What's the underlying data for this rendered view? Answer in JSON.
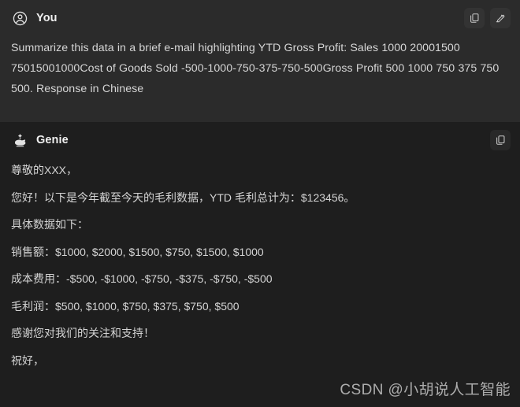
{
  "user_turn": {
    "author": "You",
    "avatar_icon": "user-circle-icon",
    "message": "Summarize this data in a brief e-mail highlighting YTD Gross Profit: Sales 1000 20001500 75015001000Cost of Goods Sold -500-1000-750-375-750-500Gross Profit 500 1000 750 375 750 500. Response in Chinese",
    "actions": [
      {
        "name": "copy-button",
        "icon": "copy-icon"
      },
      {
        "name": "edit-button",
        "icon": "edit-pencil-icon"
      }
    ]
  },
  "genie_turn": {
    "author": "Genie",
    "avatar_icon": "magic-lamp-icon",
    "actions": [
      {
        "name": "copy-button",
        "icon": "copy-icon"
      }
    ],
    "paragraphs": [
      "尊敬的XXX，",
      "您好！以下是今年截至今天的毛利数据，YTD 毛利总计为：$123456。",
      "具体数据如下：",
      "销售额：$1000, $2000, $1500, $750, $1500, $1000",
      "成本费用：-$500, -$1000, -$750, -$375, -$750, -$500",
      "毛利润：$500, $1000, $750, $375, $750, $500",
      "感谢您对我们的关注和支持！",
      "祝好，"
    ]
  },
  "watermark": {
    "text": "CSDN @小胡说人工智能"
  },
  "colors": {
    "user_background": "#2b2b2b",
    "genie_background": "#1e1e1e",
    "body_text": "#d4d4d4",
    "author_text": "#f0f0f0",
    "icon": "#c8c8c8"
  }
}
